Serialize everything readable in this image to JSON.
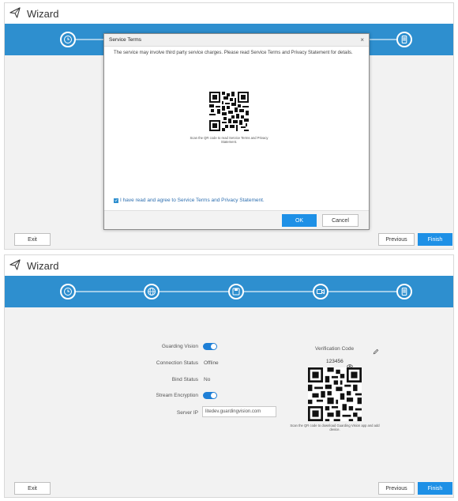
{
  "wizard_title": "Wizard",
  "colors": {
    "accent": "#2e8fcf",
    "primary_button": "#1e90e6"
  },
  "steps": [
    {
      "icon": "clock-icon"
    },
    {
      "icon": "globe-icon"
    },
    {
      "icon": "disk-icon"
    },
    {
      "icon": "camera-icon"
    },
    {
      "icon": "phone-icon"
    }
  ],
  "modal": {
    "title": "Service Terms",
    "text": "The service may involve third party service charges. Please read Service Terms and Privacy Statement for details.",
    "qr_caption": "Scan the QR code to read Service Terms and Privacy Statement.",
    "agree_label": "I have read and agree to Service Terms and Privacy Statement.",
    "agree_checked": true,
    "ok_label": "OK",
    "cancel_label": "Cancel"
  },
  "buttons": {
    "exit": "Exit",
    "previous": "Previous",
    "finish": "Finish"
  },
  "form": {
    "guarding_vision_label": "Guarding Vision",
    "guarding_vision_on": true,
    "connection_status_label": "Connection Status",
    "connection_status_value": "Offline",
    "bind_status_label": "Bind Status",
    "bind_status_value": "No",
    "stream_encryption_label": "Stream Encryption",
    "stream_encryption_on": true,
    "server_ip_label": "Server IP",
    "server_ip_value": "litedev.guardingvision.com",
    "verification_code_label": "Verification Code",
    "verification_code_value": "123456",
    "qr_caption": "Scan the QR code to download Guarding Vision app and add device."
  }
}
